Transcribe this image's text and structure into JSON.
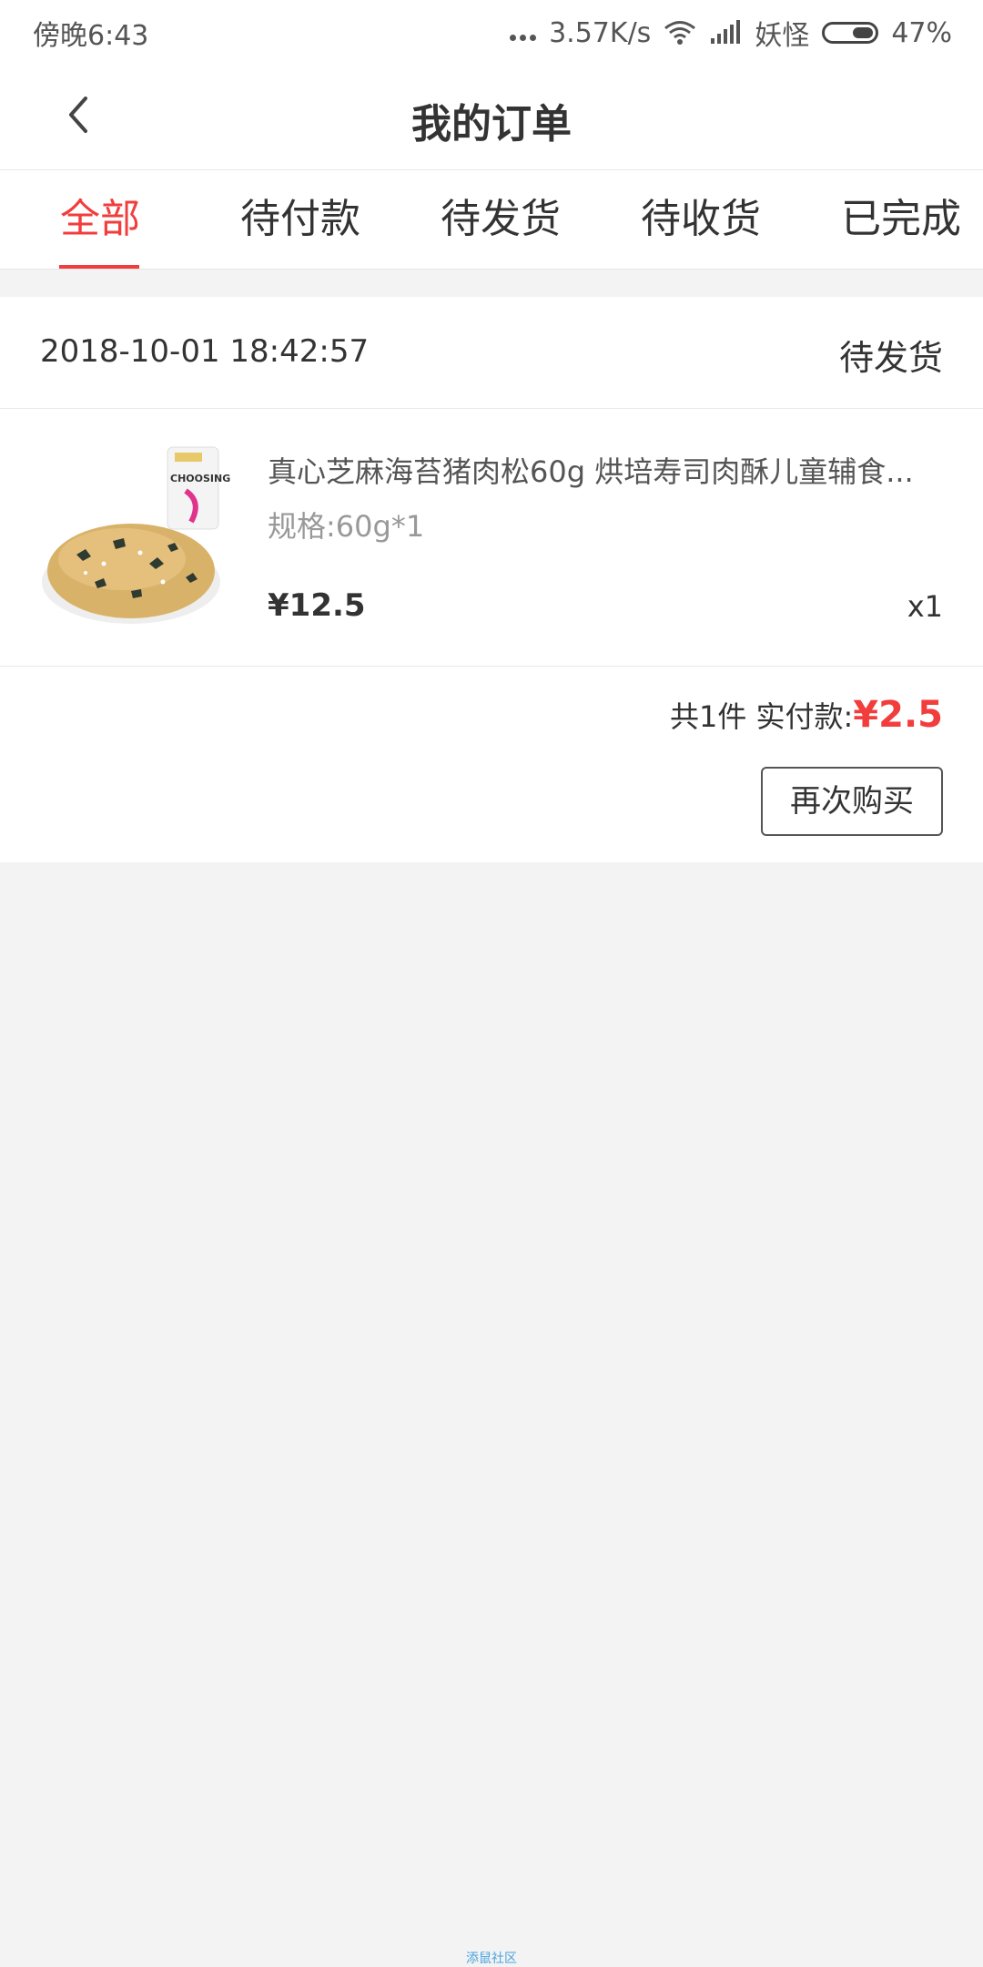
{
  "status_bar": {
    "time": "傍晚6:43",
    "network_speed": "3.57K/s",
    "carrier": "妖怪",
    "battery": "47%"
  },
  "header": {
    "title": "我的订单",
    "back_icon": "chevron-left-icon"
  },
  "tabs": [
    {
      "label": "全部",
      "active": true
    },
    {
      "label": "待付款",
      "active": false
    },
    {
      "label": "待发货",
      "active": false
    },
    {
      "label": "待收货",
      "active": false
    },
    {
      "label": "已完成",
      "active": false
    }
  ],
  "order": {
    "time": "2018-10-01 18:42:57",
    "status": "待发货",
    "product": {
      "title": "真心芝麻海苔猪肉松60g 烘培寿司肉酥儿童辅食...",
      "spec": "规格:60g*1",
      "price": "¥12.5",
      "quantity": "x1",
      "package_text": "CHOOSING"
    },
    "summary_label": "共1件 实付款:",
    "paid_amount": "¥2.5",
    "rebuy_label": "再次购买"
  },
  "watermark": "添鼠社区",
  "colors": {
    "accent": "#f23d3d",
    "background": "#f3f3f3"
  }
}
